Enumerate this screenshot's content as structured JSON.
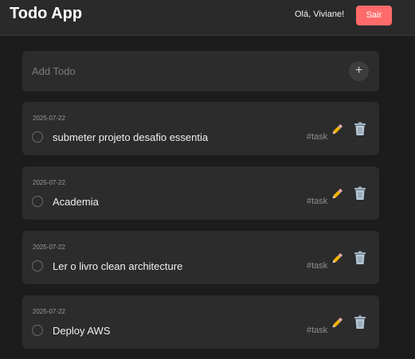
{
  "header": {
    "title": "Todo App",
    "greeting": "Olá, Viviane!",
    "logout_label": "Sair",
    "logout_color": "#ff6b6b"
  },
  "add_todo": {
    "placeholder": "Add Todo",
    "button_icon": "plus-icon",
    "button_glyph": "+"
  },
  "todos": [
    {
      "date": "2025-07-22",
      "text": "submeter projeto desafio essentia",
      "tag": "#task",
      "completed": false
    },
    {
      "date": "2025-07-22",
      "text": "Academia",
      "tag": "#task",
      "completed": false
    },
    {
      "date": "2025-07-22",
      "text": "Ler o livro clean architecture",
      "tag": "#task",
      "completed": false
    },
    {
      "date": "2025-07-22",
      "text": "Deploy AWS",
      "tag": "#task",
      "completed": false
    }
  ],
  "icons": {
    "edit": "pencil-icon",
    "delete": "trash-icon"
  },
  "colors": {
    "background": "#1c1c1c",
    "card": "#2c2c2c",
    "accent": "#ff6b6b"
  }
}
